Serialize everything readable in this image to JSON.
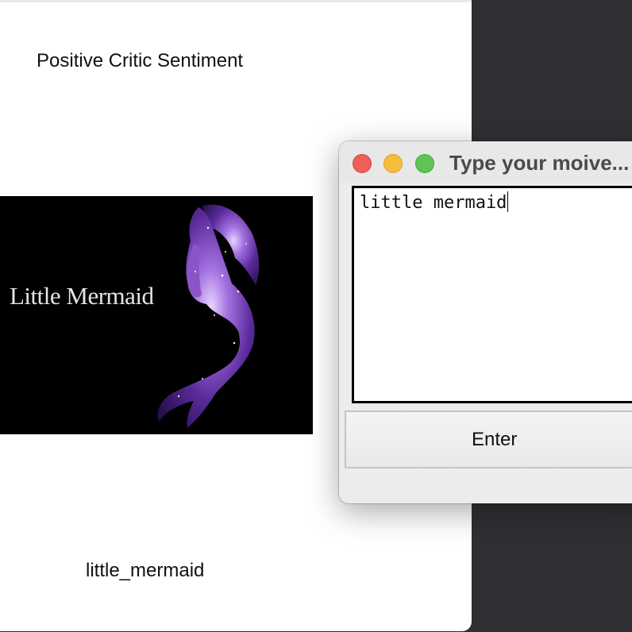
{
  "main_window": {
    "title_text": "Positive Critic Sentiment",
    "poster": {
      "text": "Little Mermaid"
    },
    "filename": "little_mermaid"
  },
  "dialog": {
    "title": "Type your moive...",
    "input_value": "little mermaid",
    "enter_label": "Enter"
  },
  "colors": {
    "close": "#ee5f57",
    "minimize": "#f6bd3b",
    "maximize": "#5fc453",
    "desktop": "#2f3034"
  }
}
